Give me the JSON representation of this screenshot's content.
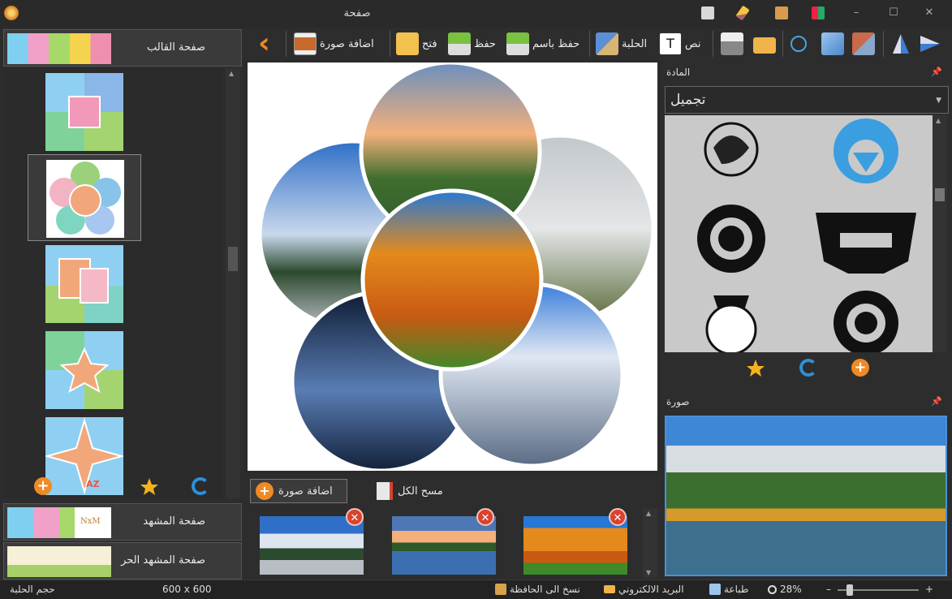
{
  "window": {
    "title": "صفحة",
    "minimize": "–",
    "maximize": "☐",
    "close": "✕"
  },
  "toolbar": {
    "back": "‹",
    "add_photo": "اضافة صورة",
    "open": "فتح",
    "save": "حفظ",
    "save_as": "حفظ باسم",
    "background": "الحلبة",
    "text": "نص",
    "text_icon_glyph": "T"
  },
  "left_panel": {
    "template_page": "صفحة القالب",
    "scene_page": "صفحة المشهد",
    "scene_logo": "NxM",
    "free_scene_page": "صفحة المشهد الحر",
    "sort_icon_glyph": "AZ"
  },
  "strip": {
    "add_photo": "اضافة صورة",
    "clear_all": "مسح الكل",
    "delete_glyph": "✕"
  },
  "right_panel": {
    "material_title": "المادة",
    "material_select": "تجميل",
    "photo_title": "صورة",
    "pin_glyph": "📌"
  },
  "status": {
    "canvas_size_label": "حجم الحلبة",
    "canvas_size": "600 x 600",
    "copy_clipboard": "نسخ الى الحافظة",
    "email": "البريد الالكتروني",
    "print": "طباعة",
    "zoom": "28%",
    "zoom_minus": "–",
    "zoom_plus": "+",
    "zoom_level": 0.12
  },
  "colors": {
    "accent_blue": "#4a90d9",
    "delete_red": "#d9432e",
    "add_orange": "#f08a24",
    "star_gold": "#f5b21e",
    "refresh_blue": "#2f8fd8"
  }
}
